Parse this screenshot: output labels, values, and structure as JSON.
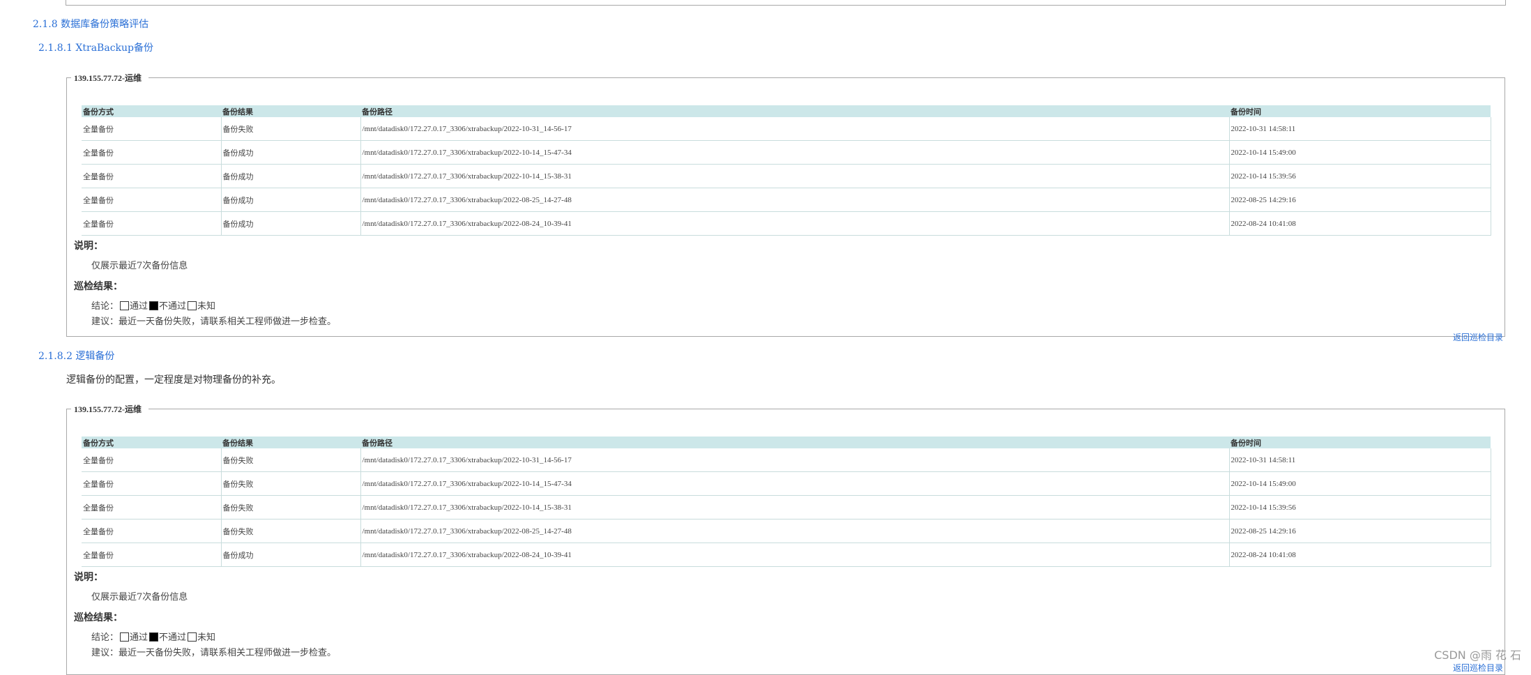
{
  "sections": {
    "s218": "2.1.8 数据库备份策略评估",
    "s2181": "2.1.8.1 XtraBackup备份",
    "s2182": "2.1.8.2 逻辑备份",
    "s2182_desc": "逻辑备份的配置，一定程度是对物理备份的补充。"
  },
  "panels": [
    {
      "legend": "139.155.77.72-运维",
      "headers": [
        "备份方式",
        "备份结果",
        "备份路径",
        "备份时间"
      ],
      "rows": [
        {
          "method": "全量备份",
          "result": "备份失败",
          "status": "fail",
          "path": "/mnt/datadisk0/172.27.0.17_3306/xtrabackup/2022-10-31_14-56-17",
          "time": "2022-10-31 14:58:11"
        },
        {
          "method": "全量备份",
          "result": "备份成功",
          "status": "ok",
          "path": "/mnt/datadisk0/172.27.0.17_3306/xtrabackup/2022-10-14_15-47-34",
          "time": "2022-10-14 15:49:00"
        },
        {
          "method": "全量备份",
          "result": "备份成功",
          "status": "ok",
          "path": "/mnt/datadisk0/172.27.0.17_3306/xtrabackup/2022-10-14_15-38-31",
          "time": "2022-10-14 15:39:56"
        },
        {
          "method": "全量备份",
          "result": "备份成功",
          "status": "ok",
          "path": "/mnt/datadisk0/172.27.0.17_3306/xtrabackup/2022-08-25_14-27-48",
          "time": "2022-08-25 14:29:16"
        },
        {
          "method": "全量备份",
          "result": "备份成功",
          "status": "ok",
          "path": "/mnt/datadisk0/172.27.0.17_3306/xtrabackup/2022-08-24_10-39-41",
          "time": "2022-08-24 10:41:08"
        }
      ],
      "note_title": "说明：",
      "note_text": "仅展示最近7次备份信息",
      "result_title": "巡检结果：",
      "conclusion_label": "结论：",
      "options": [
        "通过",
        "不通过",
        "未知"
      ],
      "checked_index": 1,
      "suggestion": "建议：最近一天备份失败，请联系相关工程师做进一步检查。",
      "back_link": "返回巡检目录"
    },
    {
      "legend": "139.155.77.72-运维",
      "headers": [
        "备份方式",
        "备份结果",
        "备份路径",
        "备份时间"
      ],
      "rows": [
        {
          "method": "全量备份",
          "result": "备份失败",
          "status": "fail",
          "path": "/mnt/datadisk0/172.27.0.17_3306/xtrabackup/2022-10-31_14-56-17",
          "time": "2022-10-31 14:58:11"
        },
        {
          "method": "全量备份",
          "result": "备份失败",
          "status": "fail",
          "path": "/mnt/datadisk0/172.27.0.17_3306/xtrabackup/2022-10-14_15-47-34",
          "time": "2022-10-14 15:49:00"
        },
        {
          "method": "全量备份",
          "result": "备份失败",
          "status": "fail",
          "path": "/mnt/datadisk0/172.27.0.17_3306/xtrabackup/2022-10-14_15-38-31",
          "time": "2022-10-14 15:39:56"
        },
        {
          "method": "全量备份",
          "result": "备份失败",
          "status": "fail",
          "path": "/mnt/datadisk0/172.27.0.17_3306/xtrabackup/2022-08-25_14-27-48",
          "time": "2022-08-25 14:29:16"
        },
        {
          "method": "全量备份",
          "result": "备份成功",
          "status": "ok",
          "path": "/mnt/datadisk0/172.27.0.17_3306/xtrabackup/2022-08-24_10-39-41",
          "time": "2022-08-24 10:41:08"
        }
      ],
      "note_title": "说明：",
      "note_text": "仅展示最近7次备份信息",
      "result_title": "巡检结果：",
      "conclusion_label": "结论：",
      "options": [
        "通过",
        "不通过",
        "未知"
      ],
      "checked_index": 1,
      "suggestion": "建议：最近一天备份失败，请联系相关工程师做进一步检查。",
      "back_link": "返回巡检目录"
    }
  ],
  "watermark": "CSDN @雨 花 石",
  "colors": {
    "link": "#2a6fd6",
    "fail": "#e8271f",
    "ok": "#2a8a2a",
    "header_bg": "#cce7e9"
  }
}
